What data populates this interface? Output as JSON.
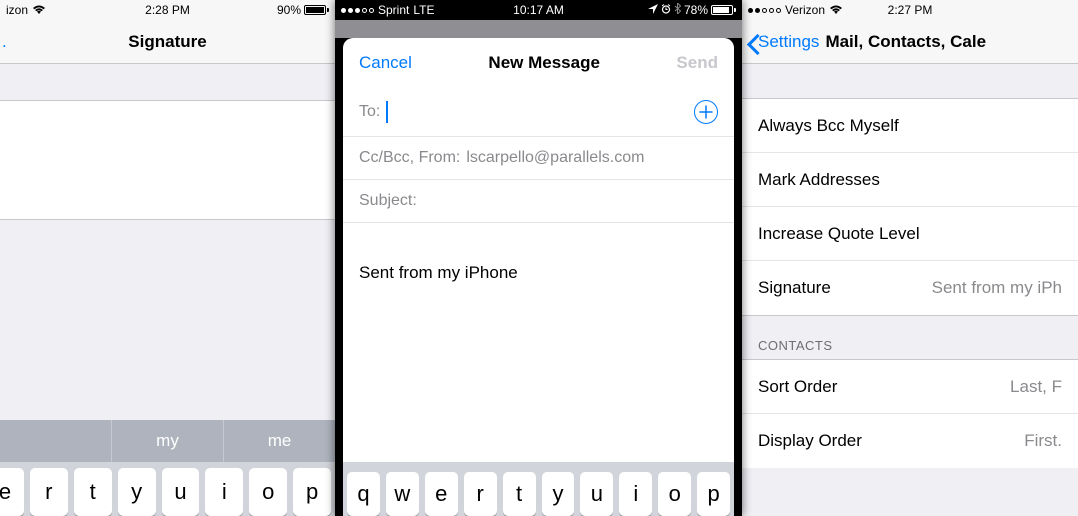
{
  "panelA": {
    "status": {
      "carrier": "izon",
      "time": "2:28 PM",
      "battery_pct": "90%",
      "battery_fill": 90
    },
    "nav": {
      "back": ".",
      "title": "Signature"
    },
    "keyboard": {
      "suggestions": [
        "",
        "my",
        "me"
      ],
      "row1": [
        "e",
        "r",
        "t",
        "y",
        "u",
        "i",
        "o",
        "p"
      ]
    }
  },
  "panelB": {
    "status": {
      "carrier": "Sprint",
      "net": "LTE",
      "time": "10:17 AM",
      "battery_pct": "78%",
      "battery_fill": 78
    },
    "nav": {
      "cancel": "Cancel",
      "title": "New Message",
      "send": "Send"
    },
    "fields": {
      "to_label": "To:",
      "ccbcc_label": "Cc/Bcc, From:",
      "from_value": "lscarpello@parallels.com",
      "subject_label": "Subject:"
    },
    "body": "Sent from my iPhone",
    "keyboard": {
      "row1": [
        "q",
        "w",
        "e",
        "r",
        "t",
        "y",
        "u",
        "i",
        "o",
        "p"
      ]
    }
  },
  "panelC": {
    "status": {
      "carrier": "Verizon",
      "time": "2:27 PM"
    },
    "nav": {
      "back": "Settings",
      "title": "Mail, Contacts, Cale"
    },
    "rows": [
      {
        "label": "Always Bcc Myself",
        "value": ""
      },
      {
        "label": "Mark Addresses",
        "value": ""
      },
      {
        "label": "Increase Quote Level",
        "value": ""
      },
      {
        "label": "Signature",
        "value": "Sent from my iPh"
      }
    ],
    "section_header": "CONTACTS",
    "rows2": [
      {
        "label": "Sort Order",
        "value": "Last, F"
      },
      {
        "label": "Display Order",
        "value": "First."
      }
    ]
  }
}
